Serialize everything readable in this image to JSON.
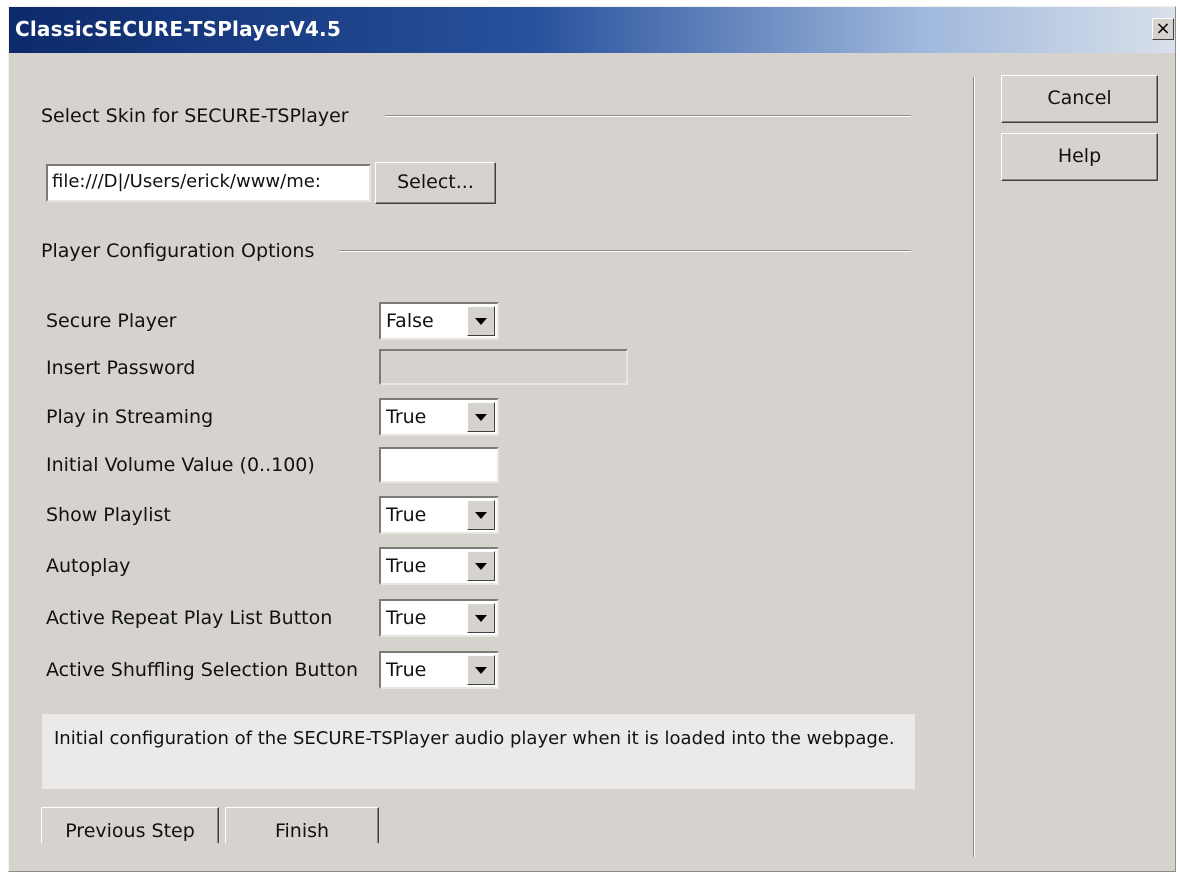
{
  "window": {
    "title": "ClassicSECURE-TSPlayerV4.5",
    "close_label": "×"
  },
  "skin": {
    "section_label": "Select Skin for SECURE-TSPlayer",
    "path_value": "file:///D|/Users/erick/www/me:",
    "select_button": "Select..."
  },
  "config": {
    "section_label": "Player Configuration Options",
    "fields": [
      {
        "label": "Secure Player",
        "type": "select",
        "value": "False"
      },
      {
        "label": "Insert Password",
        "type": "password",
        "value": ""
      },
      {
        "label": "Play in Streaming",
        "type": "select",
        "value": "True"
      },
      {
        "label": "Initial Volume Value (0..100)",
        "type": "text",
        "value": ""
      },
      {
        "label": "Show Playlist",
        "type": "select",
        "value": "True"
      },
      {
        "label": "Autoplay",
        "type": "select",
        "value": "True"
      },
      {
        "label": "Active Repeat Play List Button",
        "type": "select",
        "value": "True"
      },
      {
        "label": "Active Shuffling Selection Button",
        "type": "select",
        "value": "True"
      }
    ]
  },
  "description": "Initial configuration of the SECURE-TSPlayer audio player when it is loaded into the webpage.",
  "buttons": {
    "previous": "Previous Step",
    "finish": "Finish",
    "cancel": "Cancel",
    "help": "Help"
  },
  "icons": {
    "close": "close-icon",
    "dropdown": "chevron-down-icon"
  }
}
